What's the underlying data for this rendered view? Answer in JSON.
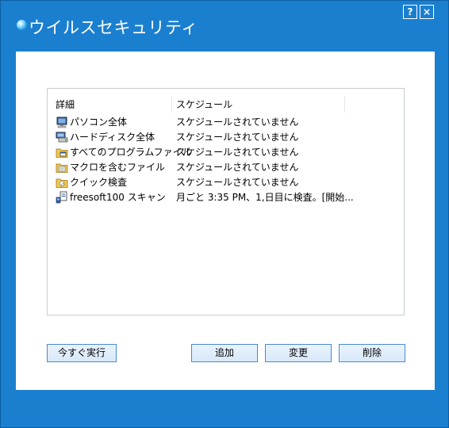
{
  "window": {
    "title": "ウイルスセキュリティ",
    "help_label": "?",
    "close_label": "×",
    "accent_color": "#1b7fd0"
  },
  "list": {
    "columns": [
      "詳細",
      "スケジュール"
    ],
    "rows": [
      {
        "icon": "computer-icon",
        "name": "パソコン全体",
        "schedule": "スケジュールされていません"
      },
      {
        "icon": "hard-drive-icon",
        "name": "ハードディスク全体",
        "schedule": "スケジュールされていません"
      },
      {
        "icon": "program-files-icon",
        "name": "すべてのプログラムファイル",
        "schedule": "スケジュールされていません"
      },
      {
        "icon": "macro-files-icon",
        "name": "マクロを含むファイル",
        "schedule": "スケジュールされていません"
      },
      {
        "icon": "quick-scan-icon",
        "name": "クイック検査",
        "schedule": "スケジュールされていません"
      },
      {
        "icon": "custom-scan-icon",
        "name": "freesoft100 スキャン",
        "schedule": "月ごと 3:35 PM、1,日目に検査。[開始..."
      }
    ]
  },
  "buttons": {
    "run_now": "今すぐ実行",
    "add": "追加",
    "change": "変更",
    "delete": "削除"
  }
}
